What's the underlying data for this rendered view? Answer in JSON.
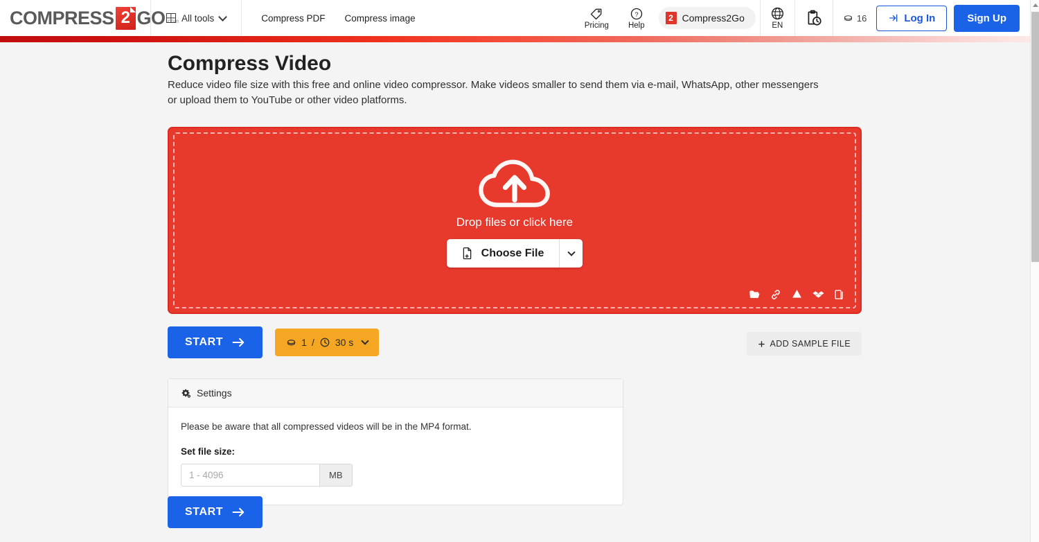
{
  "header": {
    "logo": {
      "part1": "COMPRESS",
      "badge": "2",
      "part2": "GO",
      "tld": ".com"
    },
    "all_tools": "All tools",
    "nav": [
      {
        "label": "Compress PDF"
      },
      {
        "label": "Compress image"
      }
    ],
    "pricing": "Pricing",
    "help": "Help",
    "brand_pill": {
      "badge": "2",
      "label": "Compress2Go"
    },
    "language": "EN",
    "credits": "16",
    "login": "Log In",
    "signup": "Sign Up"
  },
  "main": {
    "title": "Compress Video",
    "description": "Reduce video file size with this free and online video compressor. Make videos smaller to send them via e-mail, WhatsApp, other messengers or upload them to YouTube or other video platforms.",
    "dropzone": {
      "text": "Drop files or click here",
      "choose_file": "Choose File",
      "sources": [
        "folder-icon",
        "link-icon",
        "google-drive-icon",
        "dropbox-icon",
        "device-copy-icon"
      ]
    },
    "start_label": "START",
    "limit_badge": {
      "credits": "1",
      "separator": "/",
      "time": "30 s"
    },
    "add_sample": "ADD SAMPLE FILE",
    "settings": {
      "title": "Settings",
      "note": "Please be aware that all compressed videos will be in the MP4 format.",
      "field_label": "Set file size:",
      "input_placeholder": "1 - 4096",
      "unit": "MB"
    },
    "start_bottom_label": "START"
  },
  "colors": {
    "brand_red": "#e8392d",
    "accent_blue": "#1a62e8",
    "badge_orange": "#f5a623"
  }
}
